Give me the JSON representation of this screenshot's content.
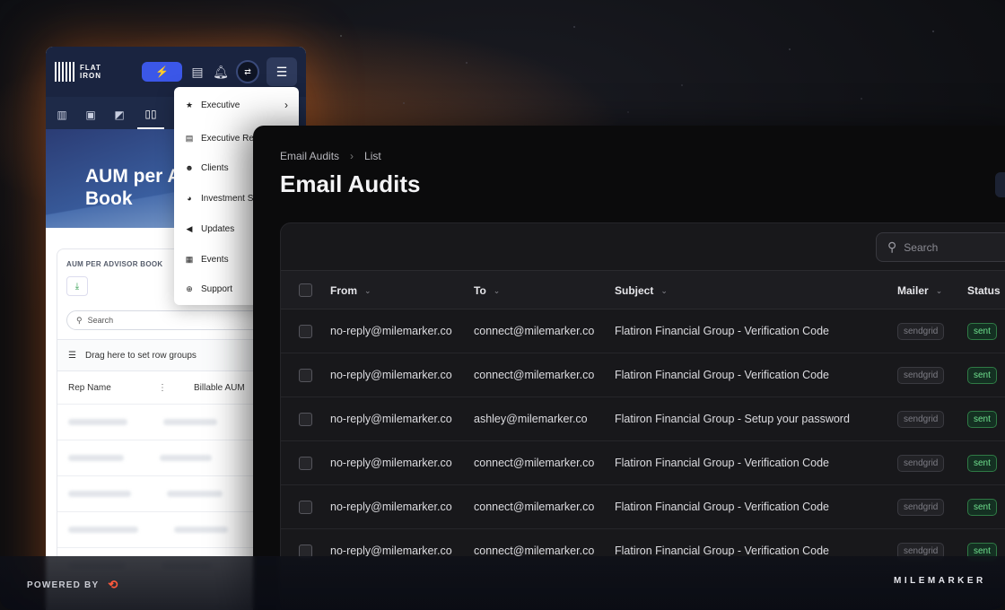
{
  "colors": {
    "accent": "#3b57e8",
    "status_sent": "#6fe08e",
    "brand_orange": "#ff5a3c"
  },
  "back_app": {
    "logo_line1": "FLAT",
    "logo_line2": "IRON",
    "bolt_icon": "⚡",
    "avatar_text": "⇄",
    "hero_title_line1": "AUM per A",
    "hero_title_line2": "Book",
    "card_title": "AUM PER ADVISOR BOOK",
    "search_placeholder": "Search",
    "group_hint": "Drag here to set row groups",
    "col_rep": "Rep Name",
    "col_aum": "Billable AUM"
  },
  "dropdown": {
    "items": [
      {
        "label": "Executive",
        "icon": "star-icon"
      },
      {
        "label": "Executive Re",
        "icon": "document-icon"
      },
      {
        "label": "Clients",
        "icon": "users-icon"
      },
      {
        "label": "Investment S",
        "icon": "pie-chart-icon"
      },
      {
        "label": "Updates",
        "icon": "megaphone-icon"
      },
      {
        "label": "Events",
        "icon": "calendar-icon"
      },
      {
        "label": "Support",
        "icon": "lifebuoy-icon"
      }
    ]
  },
  "main": {
    "breadcrumb": [
      "Email Audits",
      "List"
    ],
    "title": "Email Audits",
    "search_placeholder": "Search",
    "columns": [
      "From",
      "To",
      "Subject",
      "Mailer",
      "Status"
    ],
    "rows": [
      {
        "from": "no-reply@milemarker.co",
        "to": "connect@milemarker.co",
        "subject": "Flatiron Financial Group - Verification Code",
        "mailer": "sendgrid",
        "status": "sent"
      },
      {
        "from": "no-reply@milemarker.co",
        "to": "connect@milemarker.co",
        "subject": "Flatiron Financial Group - Verification Code",
        "mailer": "sendgrid",
        "status": "sent"
      },
      {
        "from": "no-reply@milemarker.co",
        "to": "ashley@milemarker.co",
        "subject": "Flatiron Financial Group - Setup your password",
        "mailer": "sendgrid",
        "status": "sent"
      },
      {
        "from": "no-reply@milemarker.co",
        "to": "connect@milemarker.co",
        "subject": "Flatiron Financial Group - Verification Code",
        "mailer": "sendgrid",
        "status": "sent"
      },
      {
        "from": "no-reply@milemarker.co",
        "to": "connect@milemarker.co",
        "subject": "Flatiron Financial Group - Verification Code",
        "mailer": "sendgrid",
        "status": "sent"
      },
      {
        "from": "no-reply@milemarker.co",
        "to": "connect@milemarker.co",
        "subject": "Flatiron Financial Group - Verification Code",
        "mailer": "sendgrid",
        "status": "sent"
      }
    ]
  },
  "footer": {
    "powered_by": "POWERED BY",
    "brand_mark": "⟲",
    "right_logo": "MILEMARKER"
  }
}
